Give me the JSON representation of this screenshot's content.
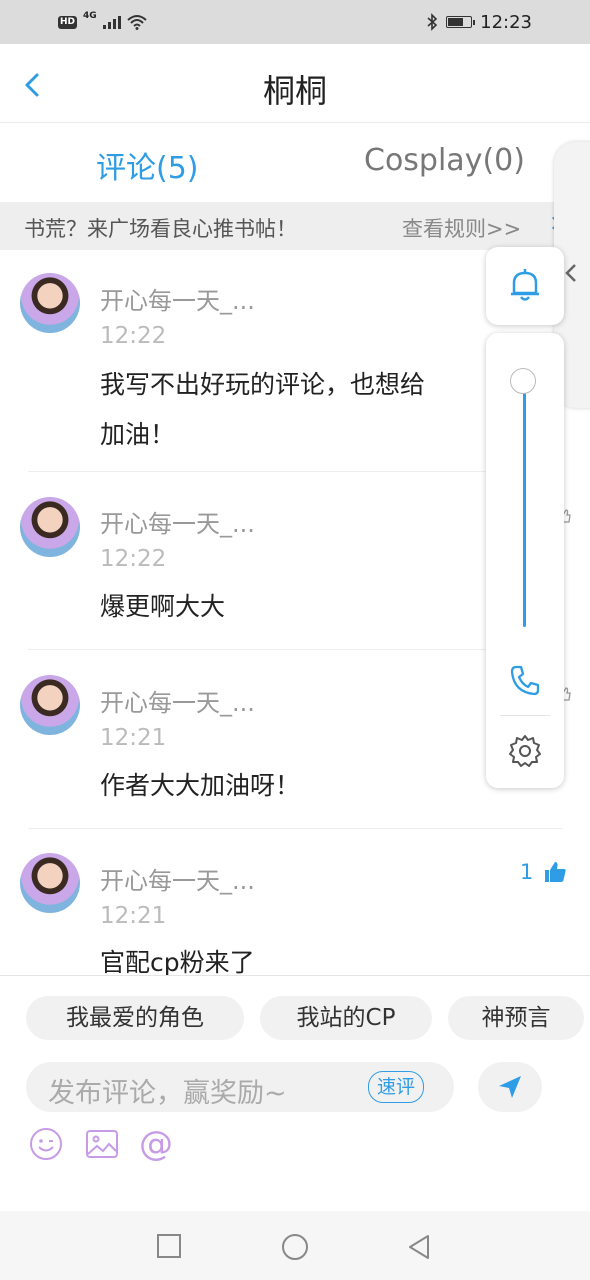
{
  "status_bar": {
    "network": "4G",
    "hd_badge": "HD",
    "time": "12:23",
    "battery_percent": 75
  },
  "header": {
    "title": "桐桐"
  },
  "tabs": [
    {
      "label": "评论(5)",
      "active": true
    },
    {
      "label": "Cosplay(0)",
      "active": false
    }
  ],
  "banner": {
    "text": "书荒？来广场看良心推书帖！",
    "link": "查看规则>>",
    "close": "×"
  },
  "comments": [
    {
      "user": "开心每一天_...",
      "time": "12:22",
      "lines": [
        "我写不出好玩的评论，也想给",
        "加油！"
      ]
    },
    {
      "user": "开心每一天_...",
      "time": "12:22",
      "lines": [
        "爆更啊大大"
      ]
    },
    {
      "user": "开心每一天_...",
      "time": "12:21",
      "lines": [
        "作者大大加油呀！"
      ]
    },
    {
      "user": "开心每一天_...",
      "time": "12:21",
      "lines": [
        "官配cp粉来了"
      ],
      "likes": "1"
    }
  ],
  "quick_tags": [
    "我最爱的角色",
    "我站的CP",
    "神预言"
  ],
  "comment_input": {
    "placeholder": "发布评论，赢奖励~",
    "quick_badge": "速评"
  },
  "toolbar_icons": [
    "emoji-icon",
    "image-icon",
    "at-icon"
  ],
  "volume_panel": {
    "level": 1.0
  },
  "colors": {
    "accent": "#2f9de5",
    "tool_icon": "#c79be6"
  }
}
